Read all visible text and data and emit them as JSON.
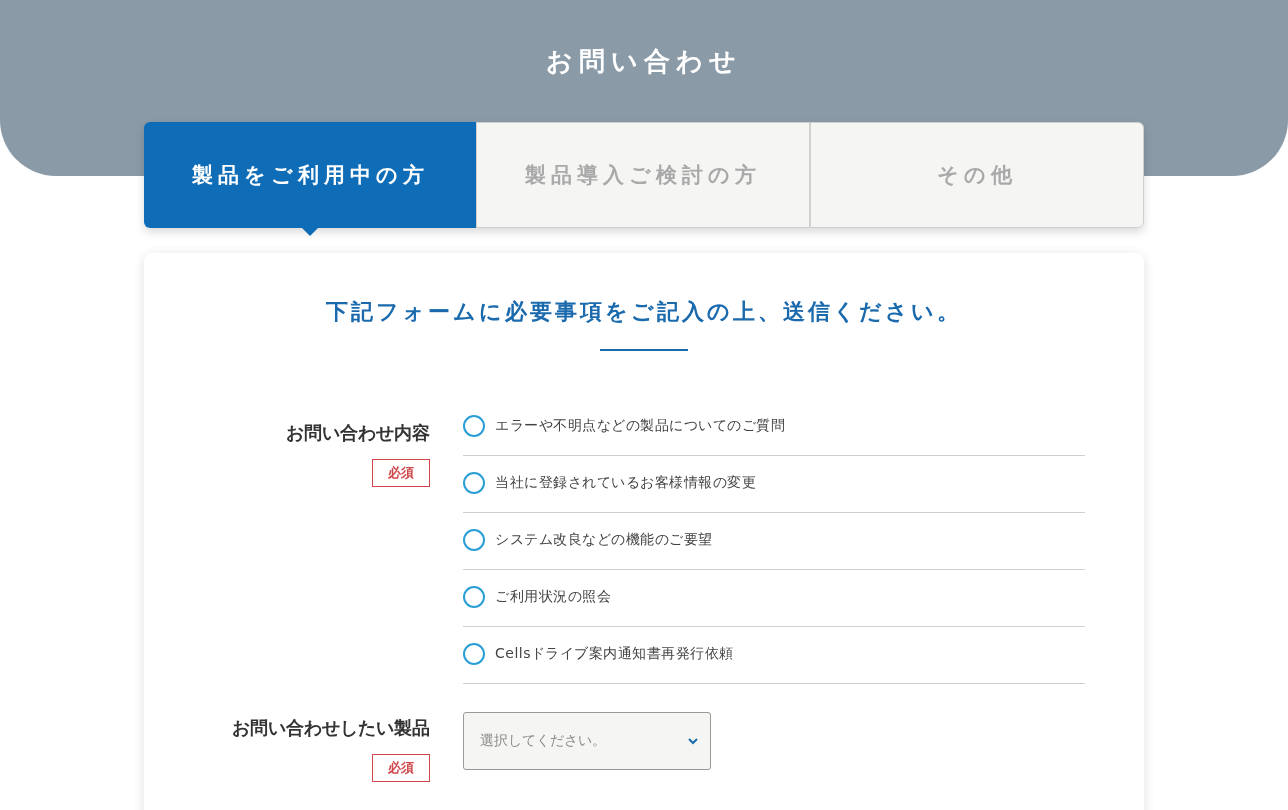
{
  "header": {
    "title": "お問い合わせ"
  },
  "tabs": [
    {
      "label": "製品をご利用中の方",
      "selected": true
    },
    {
      "label": "製品導入ご検討の方",
      "selected": false
    },
    {
      "label": "その他",
      "selected": false
    }
  ],
  "form": {
    "lead": "下記フォームに必要事項をご記入の上、送信ください。",
    "fields": [
      {
        "kind": "radio",
        "label": "お問い合わせ内容",
        "required": "必須",
        "options": [
          {
            "label": "エラーや不明点などの製品についてのご質問",
            "selected": false
          },
          {
            "label": "当社に登録されているお客様情報の変更",
            "selected": false
          },
          {
            "label": "システム改良などの機能のご要望",
            "selected": false
          },
          {
            "label": "ご利用状況の照会",
            "selected": false
          },
          {
            "label": "Cellsドライブ案内通知書再発行依頼",
            "selected": false
          }
        ]
      },
      {
        "kind": "select",
        "label": "お問い合わせしたい製品",
        "required": "必須",
        "placeholder": "選択してください。"
      }
    ]
  }
}
